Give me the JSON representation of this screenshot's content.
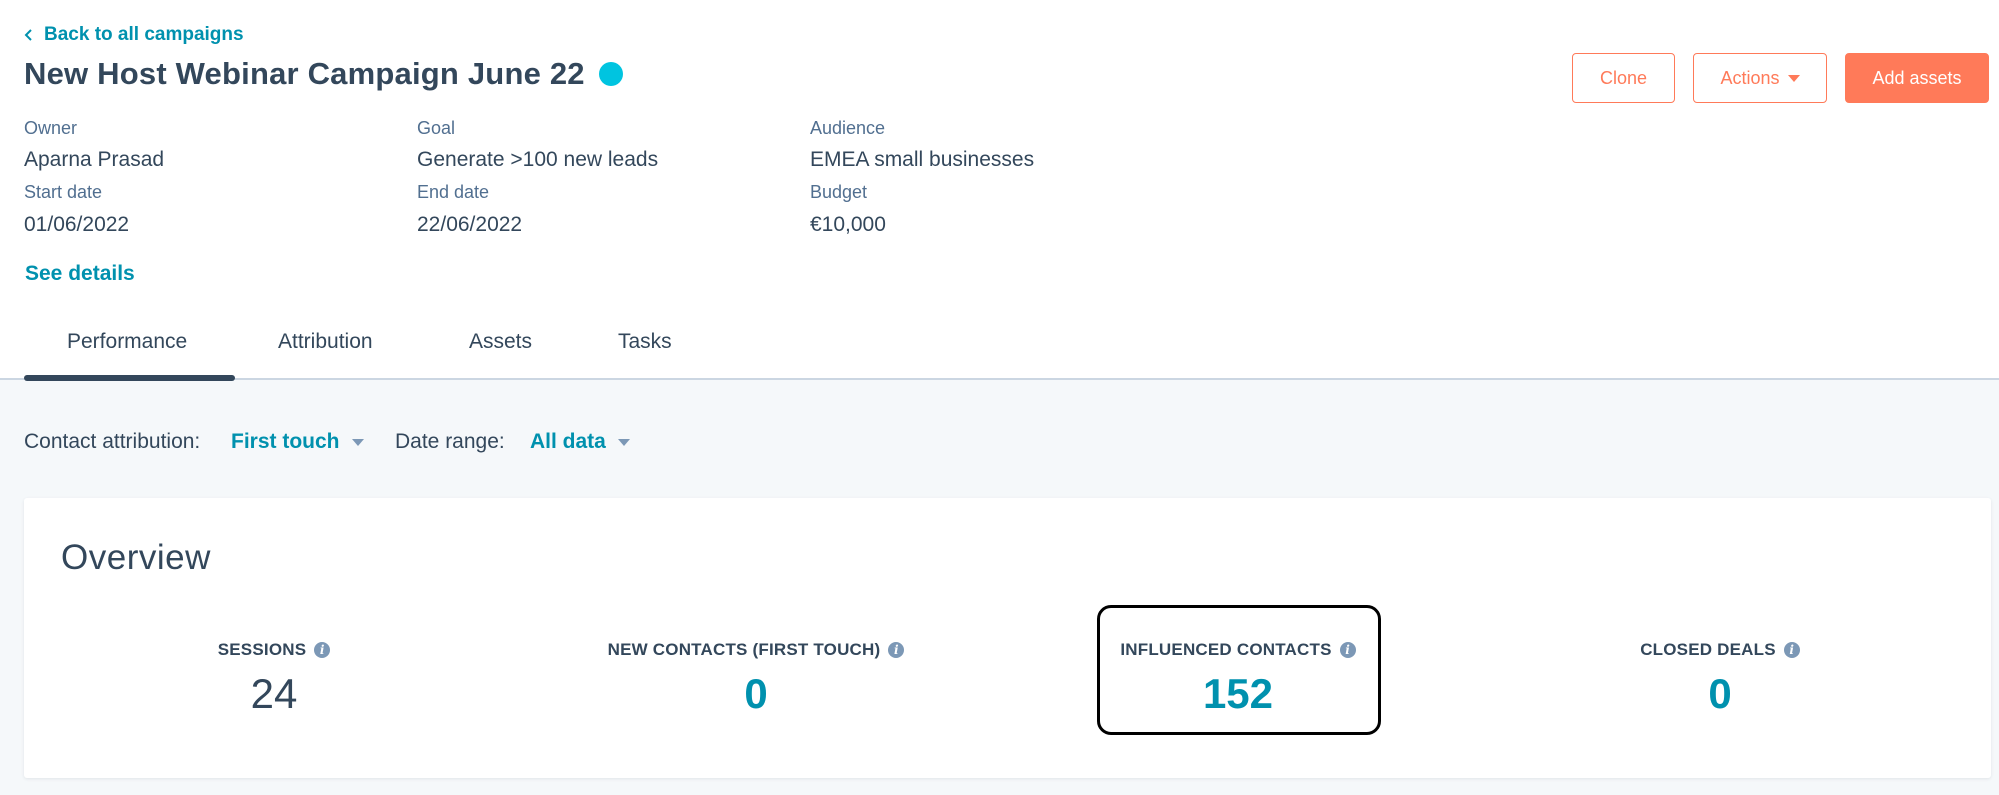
{
  "header": {
    "back_link": "Back to all campaigns",
    "title": "New Host Webinar Campaign June 22",
    "status_color": "#00c4e0"
  },
  "actions": {
    "clone": "Clone",
    "actions": "Actions",
    "add_assets": "Add assets"
  },
  "details": {
    "owner_label": "Owner",
    "owner_value": "Aparna Prasad",
    "goal_label": "Goal",
    "goal_value": "Generate >100 new leads",
    "audience_label": "Audience",
    "audience_value": "EMEA small businesses",
    "start_label": "Start date",
    "start_value": "01/06/2022",
    "end_label": "End date",
    "end_value": "22/06/2022",
    "budget_label": "Budget",
    "budget_value": "€10,000",
    "see_details": "See details"
  },
  "tabs": [
    {
      "label": "Performance",
      "active": true
    },
    {
      "label": "Attribution",
      "active": false
    },
    {
      "label": "Assets",
      "active": false
    },
    {
      "label": "Tasks",
      "active": false
    }
  ],
  "filters": {
    "attribution_label": "Contact attribution:",
    "attribution_value": "First touch",
    "date_label": "Date range:",
    "date_value": "All data"
  },
  "overview": {
    "title": "Overview",
    "stats": [
      {
        "label": "SESSIONS",
        "value": "24"
      },
      {
        "label": "NEW CONTACTS (FIRST TOUCH)",
        "value": "0"
      },
      {
        "label": "INFLUENCED CONTACTS",
        "value": "152"
      },
      {
        "label": "CLOSED DEALS",
        "value": "0"
      }
    ]
  },
  "colors": {
    "accent": "#0091ae",
    "primary_button": "#ff7a59",
    "text": "#33475b"
  }
}
